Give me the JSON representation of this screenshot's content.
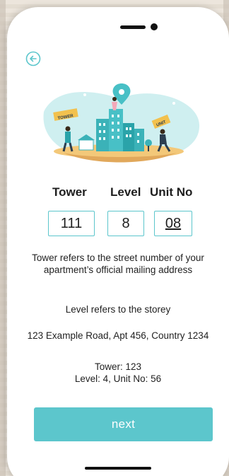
{
  "form": {
    "tower_label": "Tower",
    "level_label": "Level",
    "unit_label": "Unit No",
    "tower_value": "111",
    "level_value": "8",
    "unit_value": "08"
  },
  "help": {
    "tower_text": "Tower refers to the street number of your apartment’s official mailing address",
    "level_text": "Level refers to the storey",
    "example_address": "123 Example Road, Apt 456, Country 1234",
    "example_tower": "Tower: 123",
    "example_level_unit": "Level: 4, Unit No: 56"
  },
  "actions": {
    "next_label": "next"
  },
  "illustration": {
    "sign_left": "TOWER",
    "sign_right": "UNIT"
  },
  "colors": {
    "accent": "#5cc6cc",
    "illustration_blob": "#cfeff0",
    "ground": "#f3c879"
  },
  "icons": {
    "back": "arrow-left-circle-icon"
  }
}
